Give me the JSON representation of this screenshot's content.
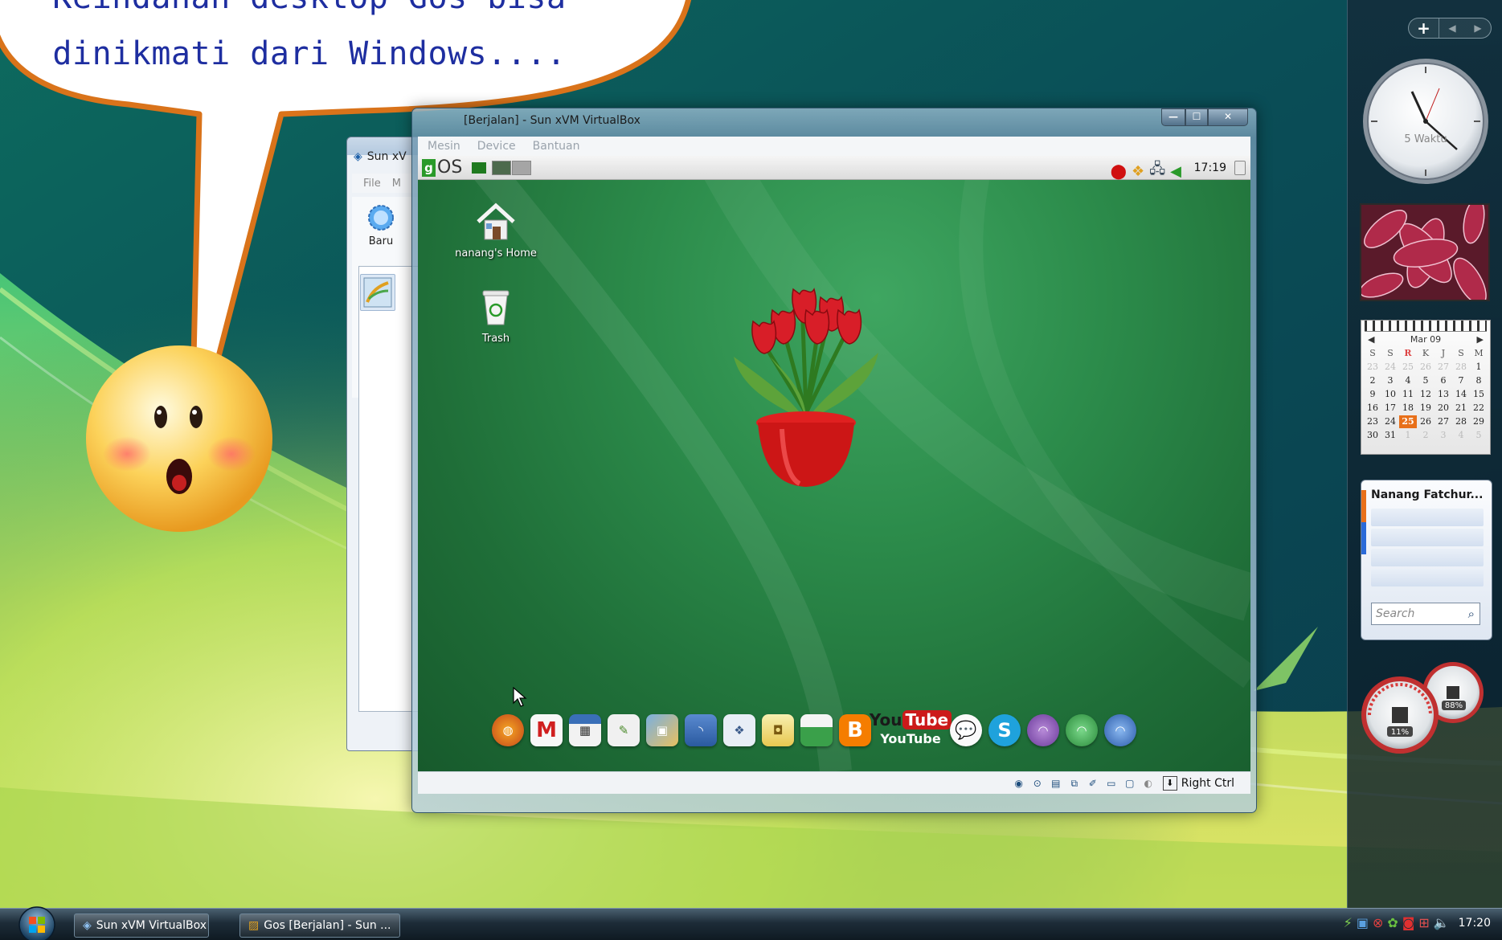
{
  "bubble": {
    "line1": "Keindahan desktop Gos bisa",
    "line2": "dinikmati dari Windows...."
  },
  "back_window": {
    "title": "Sun xV",
    "menu": [
      "File",
      "M"
    ],
    "new_button": "Baru"
  },
  "vbox": {
    "title": "Gos [Berjalan] - Sun xVM VirtualBox",
    "title_visible": "[Berjalan] - Sun xVM VirtualBox",
    "menu": [
      "Mesin",
      "Device",
      "Bantuan"
    ],
    "status_label": "Right Ctrl"
  },
  "guest": {
    "logo_text": "OS",
    "clock": "17:19",
    "desktop_icons": [
      {
        "label": "nanang's Home",
        "icon": "home-icon"
      },
      {
        "label": "Trash",
        "icon": "trash-icon"
      }
    ],
    "dock": [
      "firefox",
      "gmail",
      "calendar",
      "text-editor",
      "image-viewer",
      "rss",
      "book",
      "shopping-bag",
      "photo",
      "blogger",
      "youtube",
      "chat",
      "skype",
      "openoffice-impress",
      "openoffice-calc",
      "openoffice-writer"
    ],
    "youtube_label": "YouTube",
    "youtube_logo_you": "You",
    "youtube_logo_tube": "Tube"
  },
  "sidebar": {
    "clock_label": "5 Waktu",
    "calendar": {
      "month": "Mar 09",
      "headers": [
        "S",
        "S",
        "R",
        "K",
        "J",
        "S",
        "M"
      ],
      "rows": [
        [
          "23",
          "24",
          "25",
          "26",
          "27",
          "28",
          "1"
        ],
        [
          "2",
          "3",
          "4",
          "5",
          "6",
          "7",
          "8"
        ],
        [
          "9",
          "10",
          "11",
          "12",
          "13",
          "14",
          "15"
        ],
        [
          "16",
          "17",
          "18",
          "19",
          "20",
          "21",
          "22"
        ],
        [
          "23",
          "24",
          "25",
          "26",
          "27",
          "28",
          "29"
        ],
        [
          "30",
          "31",
          "1",
          "2",
          "3",
          "4",
          "5"
        ]
      ],
      "today": "25"
    },
    "feed_title": "Nanang Fatchur...",
    "search_placeholder": "Search",
    "cpu_percent": "11%",
    "mem_percent": "88%"
  },
  "taskbar": {
    "buttons": [
      "Sun xVM VirtualBox",
      "Gos [Berjalan] - Sun ..."
    ],
    "time": "17:20"
  },
  "colors": {
    "bubble_border": "#d9731a",
    "bubble_text": "#1e2ea0",
    "guest_green": "#2c8c4b",
    "accent_orange": "#e8701a"
  }
}
